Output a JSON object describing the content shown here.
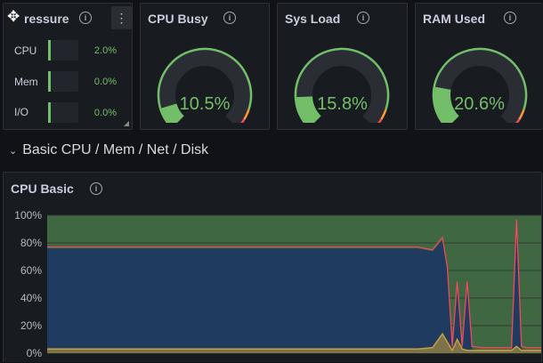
{
  "pressure": {
    "title": "ressure",
    "rows": [
      {
        "label": "CPU",
        "value": "2.0%",
        "fill": 0.02
      },
      {
        "label": "Mem",
        "value": "0.0%",
        "fill": 0.0
      },
      {
        "label": "I/O",
        "value": "0.0%",
        "fill": 0.0
      }
    ]
  },
  "gauges": [
    {
      "title": "CPU Busy",
      "value": "10.5%",
      "fraction": 0.105
    },
    {
      "title": "Sys Load",
      "value": "15.8%",
      "fraction": 0.158
    },
    {
      "title": "RAM Used",
      "value": "20.6%",
      "fraction": 0.206
    }
  ],
  "section": {
    "title": "Basic CPU / Mem / Net / Disk"
  },
  "chart_panel": {
    "title": "CPU Basic"
  },
  "colors": {
    "ok": "#73bf69",
    "warn": "#f2cc0c",
    "crit": "#f2495c",
    "idle_area": "#4a7a4a",
    "busy_area": "#1f3b5f"
  },
  "chart_data": {
    "type": "area",
    "yticks": [
      "100%",
      "80%",
      "60%",
      "40%",
      "20%",
      "0%"
    ],
    "ylim": [
      0,
      100
    ],
    "x": [
      0,
      10,
      20,
      30,
      40,
      50,
      60,
      70,
      75,
      78,
      80,
      81,
      82,
      83,
      84,
      85,
      86,
      88,
      90,
      93,
      94,
      95,
      96,
      97,
      98,
      100
    ],
    "series": [
      {
        "color": "#1f3b5f",
        "values": [
          76,
          76,
          76,
          76,
          76,
          76,
          76,
          76,
          76,
          74,
          82,
          60,
          3,
          50,
          3,
          50,
          3,
          2,
          2,
          2,
          2,
          95,
          3,
          2,
          2,
          2
        ]
      },
      {
        "color": "#f2495c",
        "values": [
          77,
          77,
          77,
          77,
          77,
          77,
          77,
          77,
          77,
          75,
          84,
          62,
          5,
          52,
          5,
          52,
          5,
          4,
          4,
          4,
          4,
          97,
          5,
          4,
          4,
          4
        ]
      },
      {
        "color": "#c8a23a",
        "values": [
          3,
          3,
          3,
          3,
          3,
          3,
          3,
          3,
          3,
          4,
          14,
          8,
          2,
          10,
          3,
          2,
          2,
          2,
          2,
          2,
          2,
          5,
          2,
          2,
          2,
          2
        ]
      }
    ]
  }
}
